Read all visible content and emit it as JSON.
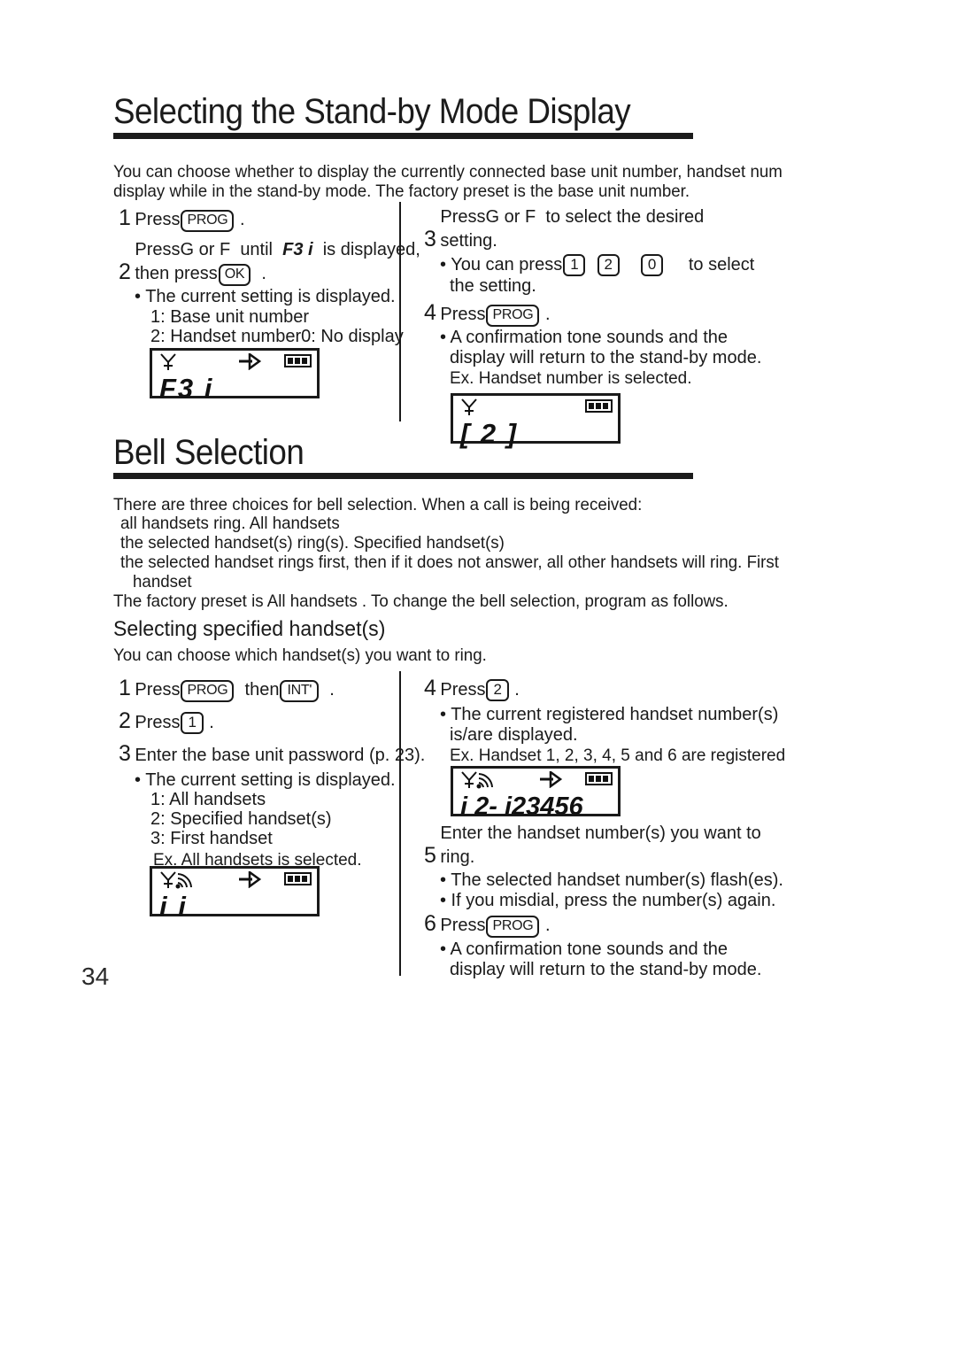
{
  "page": {
    "number": "34"
  },
  "section1": {
    "title": "Selecting the Stand-by Mode Display",
    "intro": [
      "You can choose whether to display the currently connected base unit number, handset num",
      "display while in the stand-by mode. The factory preset is the base unit number."
    ],
    "steps_left": [
      {
        "num": "1",
        "lines": [
          "Press",
          "."
        ],
        "key": "PROG"
      },
      {
        "num": "2",
        "line1_a": "Press",
        "line1_key_up": "G",
        "line1_b": "or",
        "line1_key_dn": "F",
        "line1_c": "until",
        "line1_display": "F3 i",
        "line1_d": "is displayed,",
        "line2_a": "then press",
        "line2_key": "OK",
        "line2_b": "."
      }
    ],
    "bullets_left": [
      "• The current setting is displayed.",
      "1: Base unit number",
      "2: Handset number0: No display"
    ],
    "lcd_left": {
      "text": "F3 i",
      "icons": [
        "antenna",
        "arrow",
        "battery"
      ]
    },
    "steps_right": [
      {
        "num": "3",
        "line1_a": "Press",
        "line1_key_up": "G",
        "line1_b": "or",
        "line1_key_dn": "F",
        "line1_c": "to select the desired",
        "line2": "setting."
      },
      {
        "num": "4",
        "line1_a": "Press",
        "key": "PROG",
        "line1_b": "."
      }
    ],
    "bullet_r1_a": "• You can press",
    "bullet_r1_keys": [
      "1",
      "2",
      "0"
    ],
    "bullet_r1_b": "to select",
    "bullet_r1_line2": "the setting.",
    "bullets_right_step4": [
      "• A confirmation tone sounds and the",
      "display will return to the stand-by mode."
    ],
    "ex_right": "Ex. Handset number is selected.",
    "lcd_right": {
      "text": "[ 2 ]",
      "icons": [
        "antenna",
        "battery"
      ]
    }
  },
  "section2": {
    "title": "Bell Selection",
    "intro": [
      "There are three choices for bell selection. When a call is being received:",
      "all handsets ring.  All handsets",
      "the selected handset(s) ring(s).  Specified handset(s)",
      "the selected handset rings first, then if it does not answer, all other handsets will ring.  First",
      "handset",
      "The factory preset is  All handsets . To change the bell selection, program as follows."
    ],
    "sub_head": "Selecting specified handset(s)",
    "sub_intro": "You can choose which handset(s) you want to ring.",
    "steps_left": [
      {
        "num": "1",
        "line1_a": "Press",
        "key1": "PROG",
        "line1_b": "then",
        "key2": "INT'",
        "line1_c": "."
      },
      {
        "num": "2",
        "line1_a": "Press",
        "key1": "1",
        "line1_b": "."
      },
      {
        "num": "3",
        "line1_a": "Enter the base unit password (p. 23)."
      }
    ],
    "bullets_left": [
      "• The current setting is displayed.",
      "1: All handsets",
      "2: Specified handset(s)",
      "3: First handset"
    ],
    "ex_left": "Ex. All handsets is selected.",
    "lcd_left": {
      "text": "i  i",
      "icons": [
        "antenna-signal",
        "arrow",
        "battery"
      ]
    },
    "steps_right": [
      {
        "num": "4",
        "line1_a": "Press",
        "key1": "2",
        "line1_b": "."
      },
      {
        "num": "5",
        "line1": "Enter the handset number(s) you want to",
        "line2": "ring."
      },
      {
        "num": "6",
        "line1_a": "Press",
        "key1": "PROG",
        "line1_b": "."
      }
    ],
    "bullets_right_step4": [
      "• The current registered handset number(s)",
      "is/are displayed."
    ],
    "ex_right": "Ex. Handset 1, 2, 3, 4, 5 and 6 are registered",
    "lcd_right": {
      "text": "i 2- i23456",
      "icons": [
        "antenna-signal",
        "arrow",
        "battery"
      ]
    },
    "bullets_right_step5": [
      "• The selected handset number(s) flash(es).",
      "• If you misdial, press the number(s) again."
    ],
    "bullets_right_step6": [
      "• A confirmation tone sounds and the",
      "display will return to the stand-by mode."
    ]
  }
}
